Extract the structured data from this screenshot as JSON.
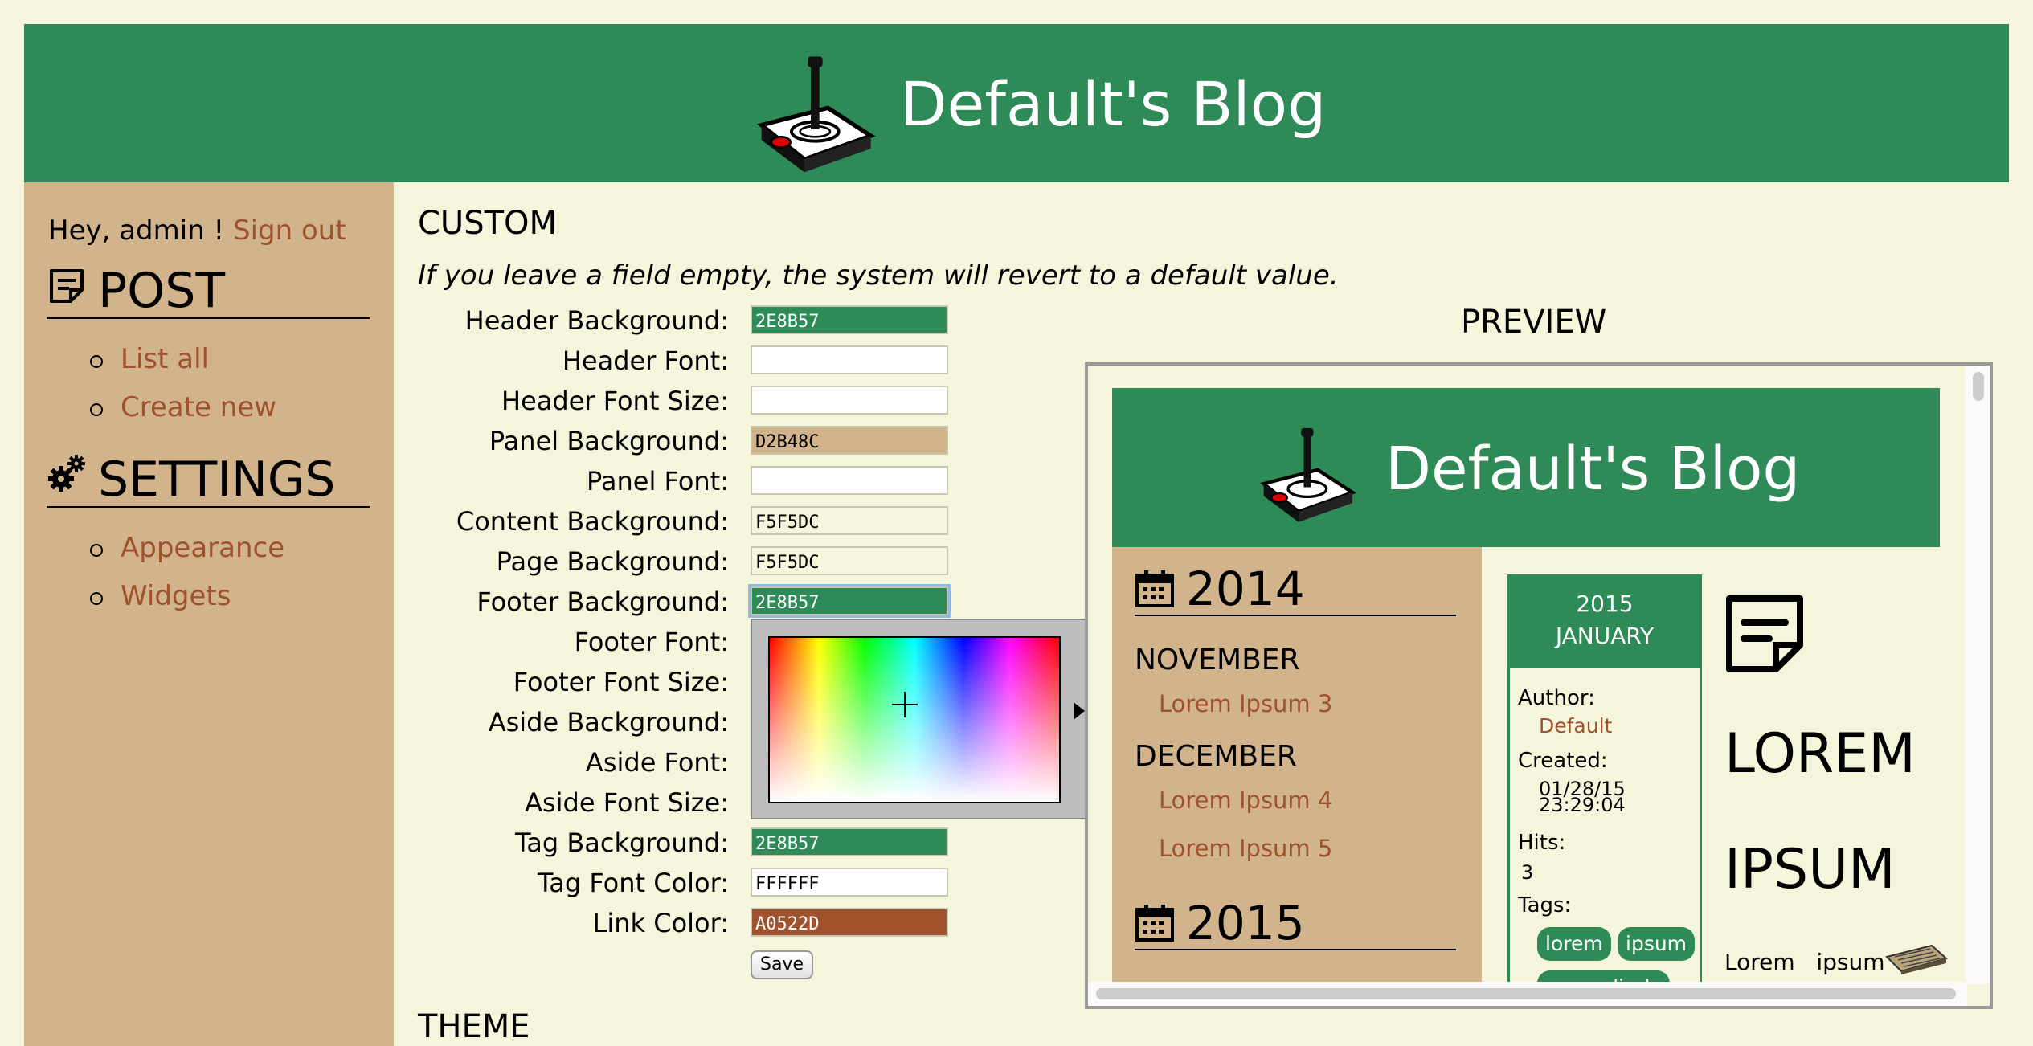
{
  "colors": {
    "header_bg": "#2E8B57",
    "panel_bg": "#D2B48C",
    "page_bg": "#F5F5DC",
    "link": "#A0522D"
  },
  "header": {
    "title": "Default's Blog",
    "logo_icon": "joystick-icon"
  },
  "sidebar": {
    "greeting": "Hey, admin !",
    "sign_out": "Sign out",
    "post_section": {
      "title": "POST",
      "icon": "note-icon",
      "items": [
        "List all",
        "Create new"
      ]
    },
    "settings_section": {
      "title": "SETTINGS",
      "icon": "gears-icon",
      "items": [
        "Appearance",
        "Widgets"
      ]
    }
  },
  "content": {
    "title": "CUSTOM",
    "note": "If you leave a field empty, the system will revert to a default value.",
    "fields": [
      {
        "label": "Header Background:",
        "value": "2E8B57"
      },
      {
        "label": "Header Font:",
        "value": ""
      },
      {
        "label": "Header Font Size:",
        "value": ""
      },
      {
        "label": "Panel Background:",
        "value": "D2B48C"
      },
      {
        "label": "Panel Font:",
        "value": ""
      },
      {
        "label": "Content Background:",
        "value": "F5F5DC"
      },
      {
        "label": "Page Background:",
        "value": "F5F5DC"
      },
      {
        "label": "Footer Background:",
        "value": "2E8B57"
      },
      {
        "label": "Footer Font:",
        "value": ""
      },
      {
        "label": "Footer Font Size:",
        "value": ""
      },
      {
        "label": "Aside Background:",
        "value": ""
      },
      {
        "label": "Aside Font:",
        "value": ""
      },
      {
        "label": "Aside Font Size:",
        "value": ""
      },
      {
        "label": "Tag Background:",
        "value": "2E8B57"
      },
      {
        "label": "Tag Font Color:",
        "value": "FFFFFF"
      },
      {
        "label": "Link Color:",
        "value": "A0522D"
      }
    ],
    "save_label": "Save",
    "theme_title": "THEME"
  },
  "preview": {
    "title": "PREVIEW",
    "blog_title": "Default's Blog",
    "archive": [
      {
        "year": "2014",
        "months": [
          {
            "name": "NOVEMBER",
            "posts": [
              "Lorem Ipsum 3"
            ]
          },
          {
            "name": "DECEMBER",
            "posts": [
              "Lorem Ipsum 4",
              "Lorem Ipsum 5"
            ]
          }
        ]
      },
      {
        "year": "2015"
      }
    ],
    "post_info": {
      "year": "2015",
      "month": "JANUARY",
      "author_label": "Author:",
      "author": "Default",
      "created_label": "Created:",
      "created_date": "01/28/15",
      "created_time": "23:29:04",
      "hits_label": "Hits:",
      "hits": "3",
      "tags_label": "Tags:",
      "tags": [
        "lorem",
        "ipsum",
        "a peculiarly"
      ]
    },
    "article": {
      "heading_1": "LOREM",
      "heading_2": "IPSUM",
      "text_1": "Lorem",
      "text_2": "ipsum"
    }
  }
}
